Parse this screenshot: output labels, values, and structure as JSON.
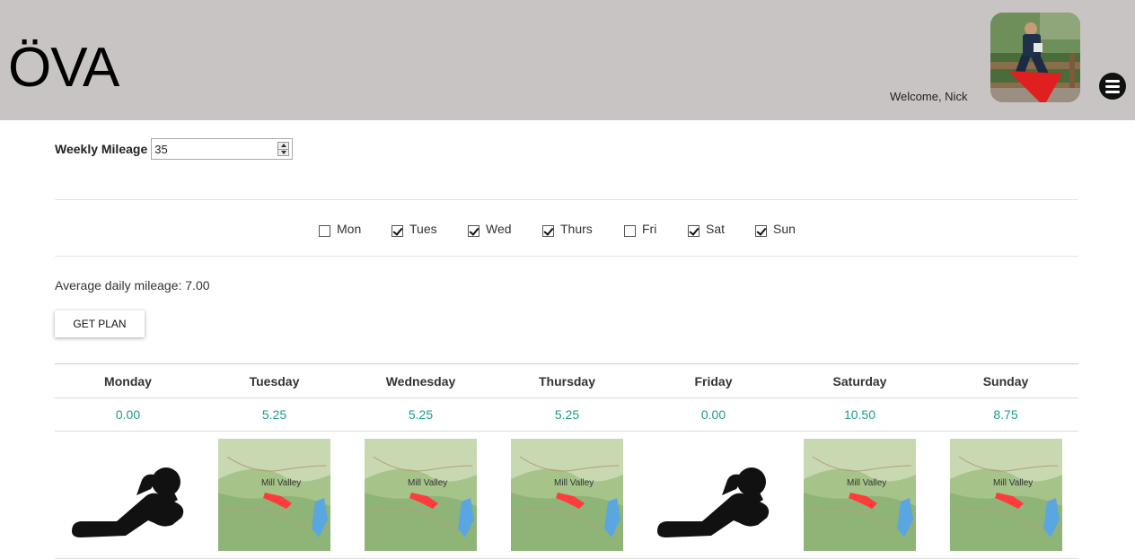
{
  "header": {
    "logo": "ÖVA",
    "welcome": "Welcome, Nick",
    "avatar_alt": "runner photo",
    "menu_icon": "menu-icon"
  },
  "form": {
    "mileage_label": "Weekly Mileage",
    "mileage_value": "35",
    "days": [
      {
        "label": "Mon",
        "checked": false
      },
      {
        "label": "Tues",
        "checked": true
      },
      {
        "label": "Wed",
        "checked": true
      },
      {
        "label": "Thurs",
        "checked": true
      },
      {
        "label": "Fri",
        "checked": false
      },
      {
        "label": "Sat",
        "checked": true
      },
      {
        "label": "Sun",
        "checked": true
      }
    ],
    "average_text": "Average daily mileage: 7.00",
    "get_plan_label": "GET PLAN"
  },
  "plan": {
    "columns": [
      "Monday",
      "Tuesday",
      "Wednesday",
      "Thursday",
      "Friday",
      "Saturday",
      "Sunday"
    ],
    "mileage": [
      "0.00",
      "5.25",
      "5.25",
      "5.25",
      "0.00",
      "10.50",
      "8.75"
    ],
    "visuals": [
      "rest-icon",
      "route-map",
      "route-map",
      "route-map",
      "rest-icon",
      "route-map",
      "route-map"
    ],
    "map_labels": [
      "",
      "Mill Valley",
      "Mill Valley",
      "Mill Valley",
      "",
      "Mill Valley",
      "Mill Valley"
    ],
    "accent_color": "#1e9a8e",
    "route_color": "#ff3b3b"
  }
}
